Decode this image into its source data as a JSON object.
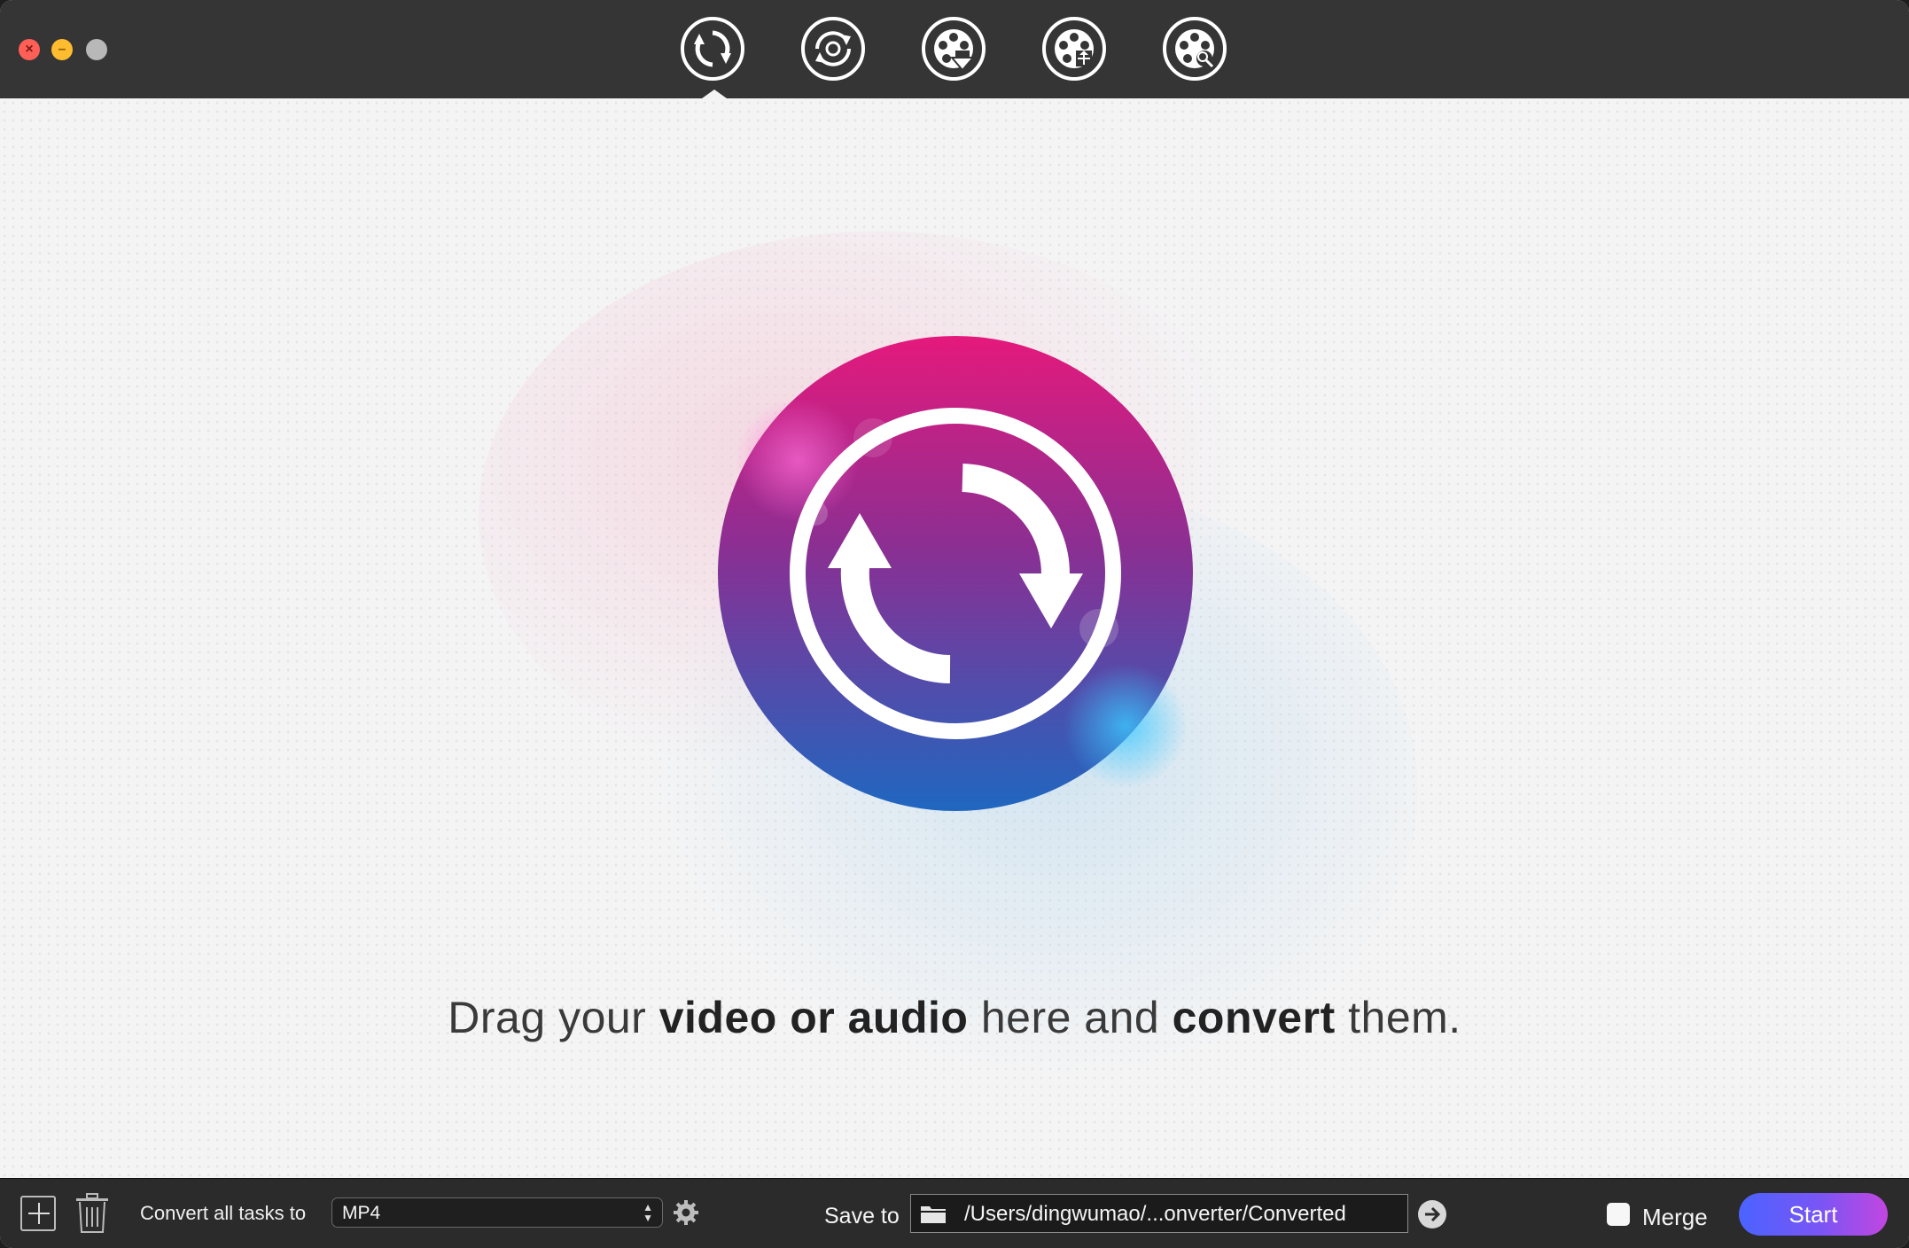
{
  "window": {
    "title": ""
  },
  "toolbar": {
    "tools": [
      {
        "name": "convert",
        "icon": "convert-arrows-icon",
        "selected": true
      },
      {
        "name": "compress",
        "icon": "refresh-gear-icon",
        "selected": false
      },
      {
        "name": "download",
        "icon": "film-reel-download-icon",
        "selected": false
      },
      {
        "name": "record",
        "icon": "film-reel-edit-icon",
        "selected": false
      },
      {
        "name": "toolbox",
        "icon": "film-reel-tools-icon",
        "selected": false
      }
    ]
  },
  "main": {
    "drop_text_parts": {
      "p1": "Drag your ",
      "b1": "video or audio",
      "p2": " here and ",
      "b2": "convert",
      "p3": " them."
    },
    "logo_icon": "convert-arrows-icon"
  },
  "bottom": {
    "add_icon": "plus-icon",
    "delete_icon": "trash-icon",
    "convert_label": "Convert all tasks to",
    "format_value": "MP4",
    "settings_icon": "gear-icon",
    "save_label": "Save to",
    "save_path": "/Users/dingwumao/...onverter/Converted",
    "folder_icon": "folder-icon",
    "open_icon": "arrow-right-icon",
    "merge_label": "Merge",
    "merge_checked": false,
    "start_label": "Start"
  },
  "colors": {
    "titlebar": "#353535",
    "bottombar": "#2b2b2b",
    "logo_top": "#e5197c",
    "logo_bottom": "#1f67c0",
    "start_gradient_start": "#4b63ff",
    "start_gradient_end": "#c246e0"
  }
}
